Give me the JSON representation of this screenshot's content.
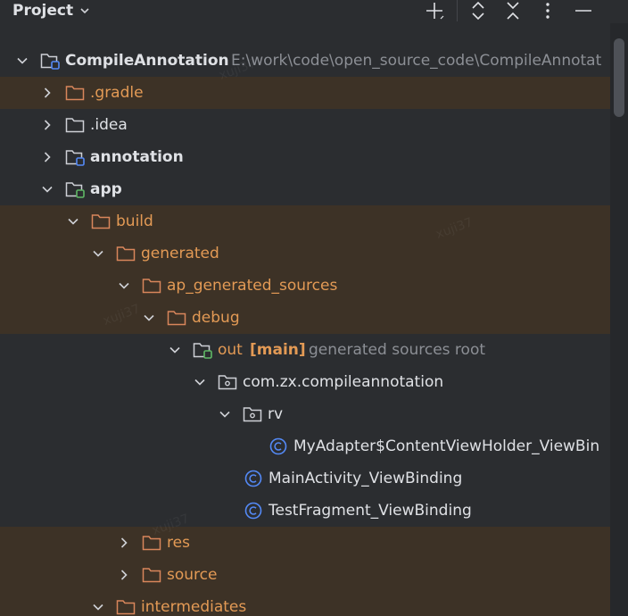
{
  "header": {
    "title": "Project"
  },
  "tree": {
    "rows": [
      {
        "label": "CompileAnnotation",
        "path": "E:\\work\\code\\open_source_code\\CompileAnnotat"
      },
      {
        "label": ".gradle"
      },
      {
        "label": ".idea"
      },
      {
        "label": "annotation"
      },
      {
        "label": "app"
      },
      {
        "label": "build"
      },
      {
        "label": "generated"
      },
      {
        "label": "ap_generated_sources"
      },
      {
        "label": "debug"
      },
      {
        "label": "out",
        "tag": "[main]",
        "hint": "generated sources root"
      },
      {
        "label": "com.zx.compileannotation"
      },
      {
        "label": "rv"
      },
      {
        "label": "MyAdapter$ContentViewHolder_ViewBin"
      },
      {
        "label": "MainActivity_ViewBinding"
      },
      {
        "label": "TestFragment_ViewBinding"
      },
      {
        "label": "res"
      },
      {
        "label": "source"
      },
      {
        "label": "intermediates"
      }
    ]
  },
  "watermark": "xuji37",
  "colors": {
    "background": "#2b2d30",
    "highlight": "#3d3226",
    "folder_orange": "#d9865b",
    "class_blue": "#548af7",
    "module_green": "#5fb865"
  },
  "icons": {
    "toolbar": [
      "plus-icon",
      "expand-all-icon",
      "collapse-all-icon",
      "more-options-icon",
      "minimize-icon"
    ],
    "tree": [
      "chevron-right-icon",
      "chevron-down-icon",
      "folder-icon",
      "module-folder-icon",
      "package-icon",
      "class-icon"
    ]
  }
}
